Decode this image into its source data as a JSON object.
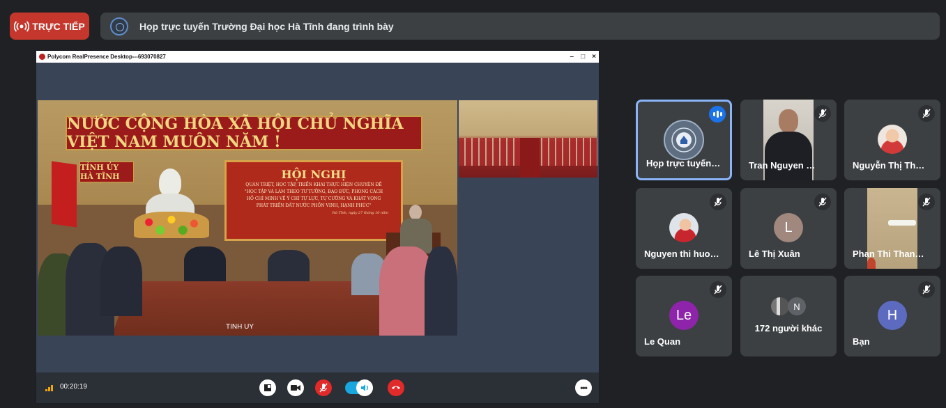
{
  "live_badge": {
    "label": "TRỰC TIẾP",
    "color": "#c5372c"
  },
  "presenting_bar": {
    "title": "Họp trực tuyến Trường Đại học Hà Tĩnh đang trình bày"
  },
  "shared_window": {
    "title": "Polycom RealPresence Desktop---693070827",
    "window_controls": [
      "–",
      "□",
      "×"
    ],
    "main_video": {
      "banner": "NƯỚC CỘNG HÒA XÃ HỘI CHỦ NGHĨA VIỆT NAM MUÔN NĂM !",
      "sign": "TỈNH ỦY HÀ TĨNH",
      "conference_title": "HỘI NGHỊ",
      "conference_lines": [
        "QUÁN TRIỆT, HỌC TẬP, TRIỂN KHAI THỰC HIỆN CHUYÊN ĐỀ",
        "\"HỌC TẬP VÀ LÀM THEO TƯ TƯỞNG, ĐẠO ĐỨC, PHONG CÁCH",
        "HỒ CHÍ MINH VỀ Ý CHÍ TỰ LỰC, TỰ CƯỜNG VÀ KHÁT VỌNG",
        "PHÁT TRIỂN ĐẤT NƯỚC PHỒN VINH, HẠNH PHÚC\""
      ],
      "conference_date": "Hà Tĩnh, ngày 27 tháng 10 năm",
      "watermark": "TINH UY"
    },
    "call_timer": "00:20:19",
    "colors": {
      "signal": "#f0a800",
      "toggle": "#19a7e0",
      "hangup": "#e12a2a"
    }
  },
  "participants": [
    {
      "name": "Họp trực tuyến Trường Đại học Hà Tĩnh",
      "display": "Họp trực tuyến…",
      "state": "speaking",
      "avatar": "school-logo"
    },
    {
      "name": "Tran Nguyen …",
      "display": "Tran Nguyen …",
      "state": "muted",
      "avatar": "camera"
    },
    {
      "name": "Nguyễn Thị Th…",
      "display": "Nguyễn Thị Th…",
      "state": "muted",
      "avatar": "photo"
    },
    {
      "name": "Nguyen thi huo…",
      "display": "Nguyen thi huo…",
      "state": "muted",
      "avatar": "photo"
    },
    {
      "name": "Lê Thị Xuân",
      "display": "Lê Thị Xuân",
      "state": "muted",
      "avatar": "L",
      "avatar_color": "#a1887f"
    },
    {
      "name": "Phan Thi Than…",
      "display": "Phan Thi Than…",
      "state": "muted",
      "avatar": "camera"
    },
    {
      "name": "Le Quan",
      "display": "Le Quan",
      "state": "muted",
      "avatar": "Le",
      "avatar_color": "#8e24aa"
    },
    {
      "name": "172 người khác",
      "display": "172 người khác",
      "state": "group",
      "avatar": "N",
      "avatar_color": "#5f6368"
    },
    {
      "name": "Bạn",
      "display": "Bạn",
      "state": "muted",
      "avatar": "H",
      "avatar_color": "#5c6bc0"
    }
  ]
}
